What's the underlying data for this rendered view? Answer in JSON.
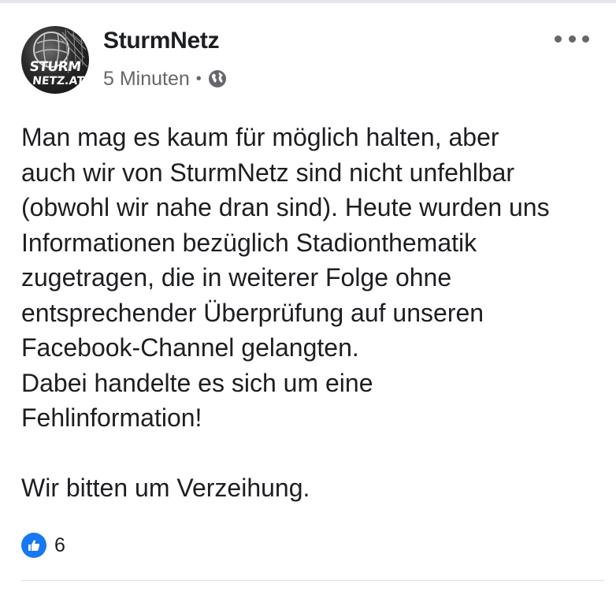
{
  "post": {
    "author": "SturmNetz",
    "avatar_text_line1": "STURM",
    "avatar_text_line2": "NETZ.AT",
    "timestamp": "5 Minuten",
    "separator": "•",
    "privacy_icon": "globe-icon",
    "more_icon": "more-options-icon",
    "text": "Man mag es kaum für möglich halten, aber\nauch wir von SturmNetz sind nicht unfehlbar\n(obwohl wir nahe dran sind). Heute wurden uns\nInformationen bezüglich Stadionthematik\nzugetragen, die in weiterer Folge ohne\nentsprechender Überprüfung auf unseren\nFacebook-Channel gelangten.\nDabei handelte es sich um eine\nFehlinformation!\n\nWir bitten um Verzeihung.",
    "reactions": {
      "icon": "thumbs-up-icon",
      "count": "6",
      "color": "#1877f2"
    }
  },
  "colors": {
    "text": "#1c1e21",
    "secondary": "#65676b",
    "like": "#1877f2"
  }
}
